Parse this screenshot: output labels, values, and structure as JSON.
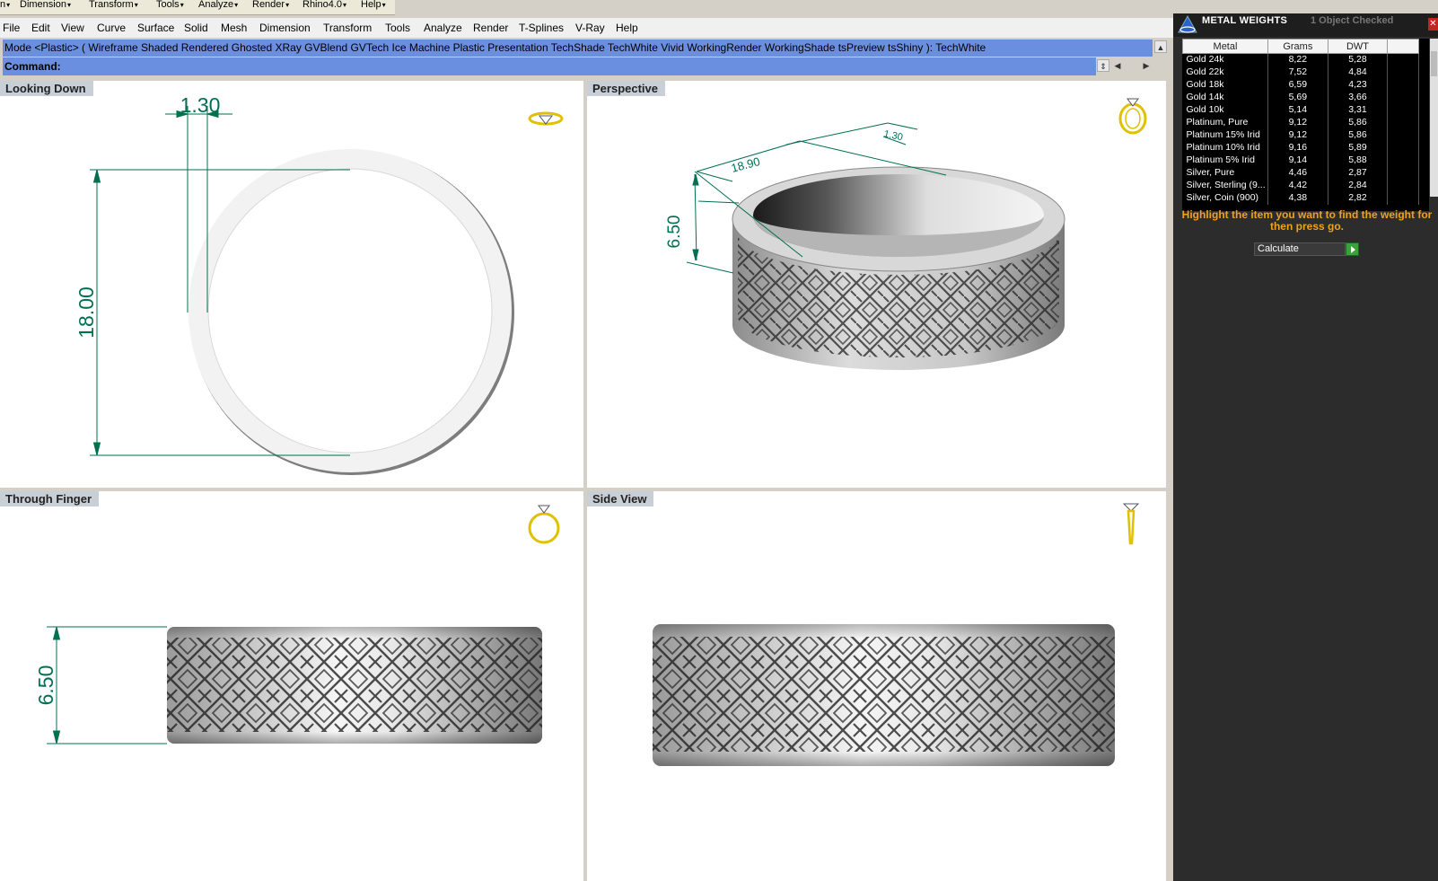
{
  "toolbar_top": [
    "n",
    "Dimension",
    "Transform",
    "Tools",
    "Analyze",
    "Render",
    "Rhino4.0",
    "Help"
  ],
  "menu": [
    "File",
    "Edit",
    "View",
    "Curve",
    "Surface",
    "Solid",
    "Mesh",
    "Dimension",
    "Transform",
    "Tools",
    "Analyze",
    "Render",
    "T-Splines",
    "V-Ray",
    "Help"
  ],
  "command": {
    "history": "Mode <Plastic> ( Wireframe  Shaded  Rendered  Ghosted  XRay  GVBlend  GVTech  Ice  Machine  Plastic  Presentation  TechShade  TechWhite  Vivid  WorkingRender  WorkingShade  tsPreview  tsShiny ): TechWhite",
    "prompt": "Command:",
    "value": ""
  },
  "viewports": {
    "looking_down": {
      "label": "Looking Down",
      "dim_width": "1.30",
      "dim_diameter": "18.00",
      "icon": "ring-top-icon"
    },
    "perspective": {
      "label": "Perspective",
      "dim_height": "6.50",
      "dim_top_a": "18.90",
      "dim_top_b": "1.30",
      "icon": "ring-perspective-icon"
    },
    "through_finger": {
      "label": "Through Finger",
      "dim_height": "6.50",
      "icon": "ring-front-icon"
    },
    "side_view": {
      "label": "Side View",
      "icon": "ring-side-icon"
    }
  },
  "panel": {
    "title": "METAL WEIGHTS",
    "status": "1 Object Checked",
    "columns": [
      "Metal",
      "Grams",
      "DWT"
    ],
    "rows": [
      [
        "Gold 24k",
        "8,22",
        "5,28"
      ],
      [
        "Gold 22k",
        "7,52",
        "4,84"
      ],
      [
        "Gold 18k",
        "6,59",
        "4,23"
      ],
      [
        "Gold 14k",
        "5,69",
        "3,66"
      ],
      [
        "Gold 10k",
        "5,14",
        "3,31"
      ],
      [
        "Platinum, Pure",
        "9,12",
        "5,86"
      ],
      [
        "Platinum 15% Irid",
        "9,12",
        "5,86"
      ],
      [
        "Platinum 10% Irid",
        "9,16",
        "5,89"
      ],
      [
        "Platinum 5% Irid",
        "9,14",
        "5,88"
      ],
      [
        "Silver, Pure",
        "4,46",
        "2,87"
      ],
      [
        "Silver, Sterling (9...",
        "4,42",
        "2,84"
      ],
      [
        "Silver, Coin (900)",
        "4,38",
        "2,82"
      ]
    ],
    "hint": "Highlight the item you want to find the weight for then press go.",
    "calc_label": "Calculate",
    "colors": {
      "bg": "#2c2c2c",
      "hint": "#f0a020",
      "go": "#3aa23a"
    }
  },
  "colors": {
    "dimension": "#007050",
    "command_bar": "#6b8fe0",
    "viewport_label": "#c9cfd6"
  }
}
